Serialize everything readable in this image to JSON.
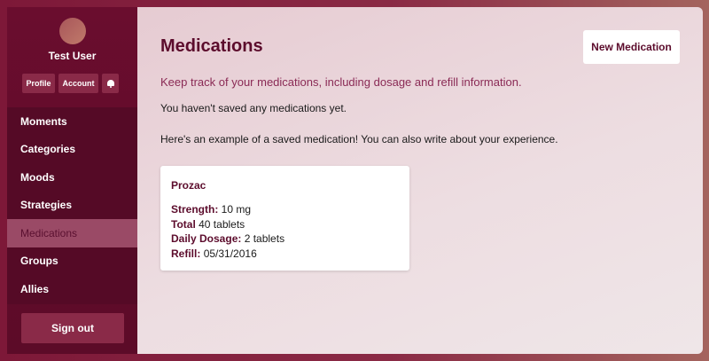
{
  "user": {
    "name": "Test User"
  },
  "profile_buttons": {
    "profile": "Profile",
    "account": "Account",
    "notifications_icon": "bell-icon"
  },
  "nav": {
    "items": [
      {
        "label": "Moments"
      },
      {
        "label": "Categories"
      },
      {
        "label": "Moods"
      },
      {
        "label": "Strategies"
      },
      {
        "label": "Medications",
        "active": true
      },
      {
        "label": "Groups"
      },
      {
        "label": "Allies"
      }
    ]
  },
  "sidebar": {
    "signout_label": "Sign out"
  },
  "main": {
    "title": "Medications",
    "new_button": "New Medication",
    "subtitle": "Keep track of your medications, including dosage and refill information.",
    "empty_text": "You haven't saved any medications yet.",
    "example_text": "Here's an example of a saved medication! You can also write about your experience."
  },
  "example_medication": {
    "name": "Prozac",
    "fields": [
      {
        "label": "Strength:",
        "value": "10 mg"
      },
      {
        "label": "Total",
        "value": "40 tablets"
      },
      {
        "label": "Daily Dosage:",
        "value": "2 tablets"
      },
      {
        "label": "Refill:",
        "value": "05/31/2016"
      }
    ]
  },
  "colors": {
    "accent": "#5c0c2c",
    "subtitle": "#8a2a55",
    "sidebar": "#6a0d2e",
    "nav_active": "#9a4a66"
  }
}
